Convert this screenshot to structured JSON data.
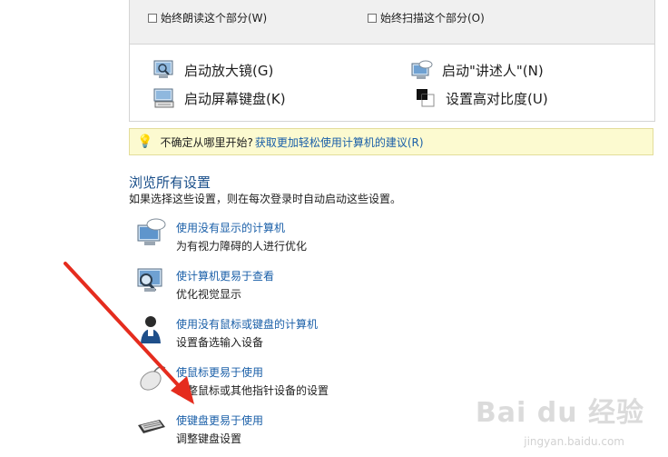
{
  "top_panel": {
    "checkbox_1": "始终朗读这个部分(W)",
    "checkbox_2": "始终扫描这个部分(O)"
  },
  "tools": {
    "magnifier": "启动放大镜(G)",
    "narrator": "启动\"讲述人\"(N)",
    "osk": "启动屏幕键盘(K)",
    "contrast": "设置高对比度(U)"
  },
  "hint": {
    "prefix": "不确定从哪里开始?",
    "link": "获取更加轻松使用计算机的建议(R)"
  },
  "browse": {
    "title": "浏览所有设置",
    "description": "如果选择这些设置，则在每次登录时自动启动这些设置。"
  },
  "settings": [
    {
      "title": "使用没有显示的计算机",
      "desc": "为有视力障碍的人进行优化",
      "icon": "speech-monitor-icon"
    },
    {
      "title": "使计算机更易于查看",
      "desc": "优化视觉显示",
      "icon": "magnify-monitor-icon"
    },
    {
      "title": "使用没有鼠标或键盘的计算机",
      "desc": "设置备选输入设备",
      "icon": "person-icon"
    },
    {
      "title": "使鼠标更易于使用",
      "desc": "调整鼠标或其他指针设备的设置",
      "icon": "mouse-icon"
    },
    {
      "title": "使键盘更易于使用",
      "desc": "调整键盘设置",
      "icon": "keyboard-icon"
    }
  ],
  "watermark": {
    "text": "Bai du 经验",
    "sub": "jingyan.baidu.com"
  },
  "colors": {
    "link": "#1a5fa8",
    "heading": "#1a4f8a",
    "hint_bg": "#fcfad0",
    "arrow": "#e52c1e"
  }
}
